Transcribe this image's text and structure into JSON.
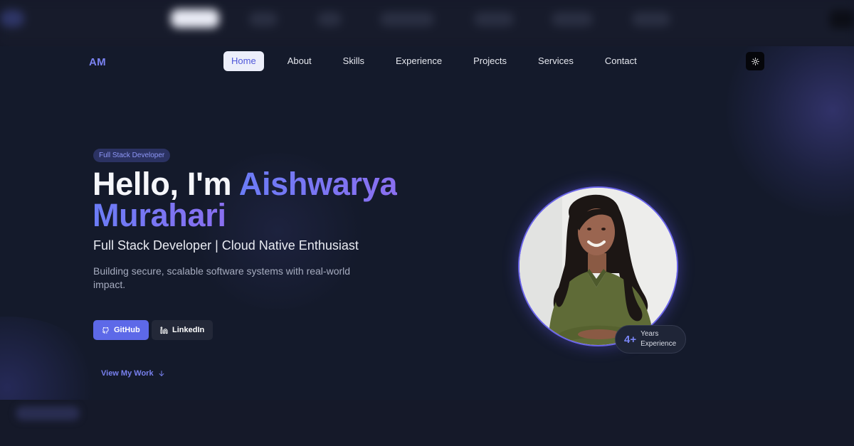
{
  "brand": {
    "logo": "AM",
    "accent": "#5d69e8"
  },
  "nav": {
    "items": [
      {
        "label": "Home",
        "active": true
      },
      {
        "label": "About",
        "active": false
      },
      {
        "label": "Skills",
        "active": false
      },
      {
        "label": "Experience",
        "active": false
      },
      {
        "label": "Projects",
        "active": false
      },
      {
        "label": "Services",
        "active": false
      },
      {
        "label": "Contact",
        "active": false
      }
    ],
    "theme_toggle_icon": "sun-icon"
  },
  "hero": {
    "badge": "Full Stack Developer",
    "greeting": "Hello, I'm ",
    "name_first": "Aishwarya",
    "name_last": "Murahari",
    "subtitle": "Full Stack Developer | Cloud Native Enthusiast",
    "description": "Building secure, scalable software systems with real-world impact.",
    "buttons": {
      "github": "GitHub",
      "linkedin": "LinkedIn"
    },
    "view_work": "View My Work"
  },
  "experience_badge": {
    "value": "4+",
    "label": "Years Experience"
  }
}
